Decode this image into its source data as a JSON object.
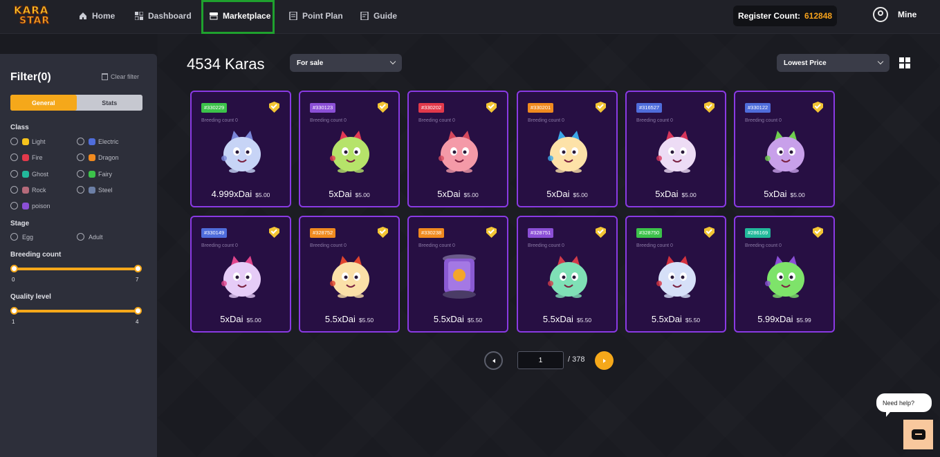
{
  "header": {
    "logo_text_top": "KARA",
    "logo_text_bottom": "STAR",
    "nav": [
      {
        "label": "Home",
        "icon": "home-icon",
        "active": false
      },
      {
        "label": "Dashboard",
        "icon": "dashboard-icon",
        "active": false
      },
      {
        "label": "Marketplace",
        "icon": "marketplace-icon",
        "active": true
      },
      {
        "label": "Point Plan",
        "icon": "point-plan-icon",
        "active": false
      },
      {
        "label": "Guide",
        "icon": "guide-icon",
        "active": false
      }
    ],
    "register_label": "Register Count:",
    "register_count": "612848",
    "user_label": "Mine"
  },
  "sidebar": {
    "title": "Filter(0)",
    "clear_label": "Clear filter",
    "tabs": [
      {
        "label": "General",
        "active": true
      },
      {
        "label": "Stats",
        "active": false
      }
    ],
    "class_title": "Class",
    "classes": [
      {
        "label": "Light",
        "color": "#f6c31c"
      },
      {
        "label": "Electric",
        "color": "#4f6ddb"
      },
      {
        "label": "Fire",
        "color": "#e3394b"
      },
      {
        "label": "Dragon",
        "color": "#f08a1f"
      },
      {
        "label": "Ghost",
        "color": "#22b99b"
      },
      {
        "label": "Fairy",
        "color": "#3cc24a"
      },
      {
        "label": "Rock",
        "color": "#b56a7a"
      },
      {
        "label": "Steel",
        "color": "#6c7fa6"
      },
      {
        "label": "poison",
        "color": "#8b4fd6"
      }
    ],
    "stage_title": "Stage",
    "stages": [
      "Egg",
      "Adult"
    ],
    "breeding_title": "Breeding count",
    "breeding_min": "0",
    "breeding_max": "7",
    "quality_title": "Quality level",
    "quality_min": "1",
    "quality_max": "4"
  },
  "main": {
    "count_label": "4534 Karas",
    "sale_filter": "For sale",
    "sort": "Lowest Price",
    "cards": [
      {
        "id": "#330229",
        "tag_color": "#3cc24a",
        "breeding": "Breeding count 0",
        "price": "4.999xDai",
        "usd": "$5.00",
        "body": "#c7d4f6",
        "accent": "#7a86d8"
      },
      {
        "id": "#330123",
        "tag_color": "#8b4fd6",
        "breeding": "Breeding count 0",
        "price": "5xDai",
        "usd": "$5.00",
        "body": "#b6e36a",
        "accent": "#e23a54"
      },
      {
        "id": "#330202",
        "tag_color": "#e3394b",
        "breeding": "Breeding count 0",
        "price": "5xDai",
        "usd": "$5.00",
        "body": "#f49aa8",
        "accent": "#d4485c"
      },
      {
        "id": "#330201",
        "tag_color": "#f08a1f",
        "breeding": "Breeding count 0",
        "price": "5xDai",
        "usd": "$5.00",
        "body": "#fde2a8",
        "accent": "#39a6e8"
      },
      {
        "id": "#316527",
        "tag_color": "#4f6ddb",
        "breeding": "Breeding count 0",
        "price": "5xDai",
        "usd": "$5.00",
        "body": "#eddcf5",
        "accent": "#d6355a"
      },
      {
        "id": "#330122",
        "tag_color": "#4f6ddb",
        "breeding": "Breeding count 0",
        "price": "5xDai",
        "usd": "$5.00",
        "body": "#c8a0ea",
        "accent": "#6fcf4e"
      },
      {
        "id": "#330149",
        "tag_color": "#4f6ddb",
        "breeding": "Breeding count 0",
        "price": "5xDai",
        "usd": "$5.00",
        "body": "#e6ccf7",
        "accent": "#e0448b"
      },
      {
        "id": "#328752",
        "tag_color": "#f08a1f",
        "breeding": "Breeding count 0",
        "price": "5.5xDai",
        "usd": "$5.50",
        "body": "#fbe0a8",
        "accent": "#e0442e"
      },
      {
        "id": "#330238",
        "tag_color": "#f08a1f",
        "breeding": "Breeding count 0",
        "price": "5.5xDai",
        "usd": "$5.50",
        "body": "#8a5ad3",
        "accent": "#f4a62a",
        "egg": true
      },
      {
        "id": "#328751",
        "tag_color": "#8b4fd6",
        "breeding": "Breeding count 0",
        "price": "5.5xDai",
        "usd": "$5.50",
        "body": "#7fe0b6",
        "accent": "#d23b4a"
      },
      {
        "id": "#328750",
        "tag_color": "#3cc24a",
        "breeding": "Breeding count 0",
        "price": "5.5xDai",
        "usd": "$5.50",
        "body": "#d6e0f8",
        "accent": "#d4323f"
      },
      {
        "id": "#286169",
        "tag_color": "#22b99b",
        "breeding": "Breeding count 0",
        "price": "5.99xDai",
        "usd": "$5.99",
        "body": "#7ee36a",
        "accent": "#8a4fd6"
      }
    ],
    "page_current": "1",
    "page_total": "/ 378"
  },
  "help": {
    "label": "Need help?"
  }
}
